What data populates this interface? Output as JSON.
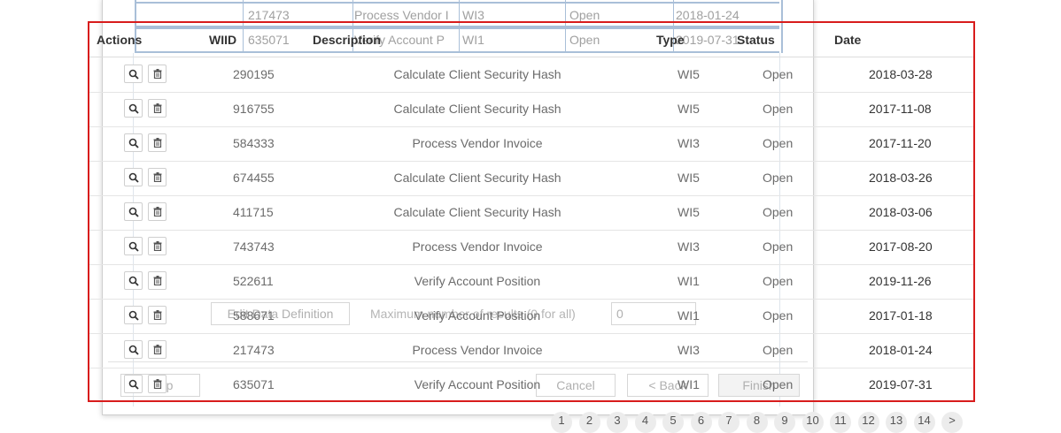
{
  "background_dialog": {
    "rows": [
      {
        "wiid": "217473",
        "description": "Process Vendor I",
        "type": "WI3",
        "status": "Open",
        "date": "2018-01-24"
      },
      {
        "wiid": "635071",
        "description": "Verify Account P",
        "type": "WI1",
        "status": "Open",
        "date": "2019-07-31"
      }
    ],
    "edit_data_definition_label": "Edit Data Definition",
    "max_results_label": "Maximum number of results (0 for all)",
    "max_results_value": "0",
    "help_label": "Help",
    "cancel_label": "Cancel",
    "back_label": "< Back",
    "finish_label": "Finish"
  },
  "table": {
    "headers": {
      "actions": "Actions",
      "wiid": "WIID",
      "description": "Description",
      "type": "Type",
      "status": "Status",
      "date": "Date"
    },
    "rows": [
      {
        "wiid": "290195",
        "description": "Calculate Client Security Hash",
        "type": "WI5",
        "status": "Open",
        "date": "2018-03-28"
      },
      {
        "wiid": "916755",
        "description": "Calculate Client Security Hash",
        "type": "WI5",
        "status": "Open",
        "date": "2017-11-08"
      },
      {
        "wiid": "584333",
        "description": "Process Vendor Invoice",
        "type": "WI3",
        "status": "Open",
        "date": "2017-11-20"
      },
      {
        "wiid": "674455",
        "description": "Calculate Client Security Hash",
        "type": "WI5",
        "status": "Open",
        "date": "2018-03-26"
      },
      {
        "wiid": "411715",
        "description": "Calculate Client Security Hash",
        "type": "WI5",
        "status": "Open",
        "date": "2018-03-06"
      },
      {
        "wiid": "743743",
        "description": "Process Vendor Invoice",
        "type": "WI3",
        "status": "Open",
        "date": "2017-08-20"
      },
      {
        "wiid": "522611",
        "description": "Verify Account Position",
        "type": "WI1",
        "status": "Open",
        "date": "2019-11-26"
      },
      {
        "wiid": "588671",
        "description": "Verify Account Position",
        "type": "WI1",
        "status": "Open",
        "date": "2017-01-18"
      },
      {
        "wiid": "217473",
        "description": "Process Vendor Invoice",
        "type": "WI3",
        "status": "Open",
        "date": "2018-01-24"
      },
      {
        "wiid": "635071",
        "description": "Verify Account Position",
        "type": "WI1",
        "status": "Open",
        "date": "2019-07-31"
      }
    ],
    "row_icons": {
      "view": "search-icon",
      "delete": "trash-icon"
    }
  },
  "pagination": {
    "pages": [
      "1",
      "2",
      "3",
      "4",
      "5",
      "6",
      "7",
      "8",
      "9",
      "10",
      "11",
      "12",
      "13",
      "14",
      ">"
    ]
  },
  "colors": {
    "highlight_border": "#d81c1c",
    "grid_blue": "#a9bfd8"
  }
}
